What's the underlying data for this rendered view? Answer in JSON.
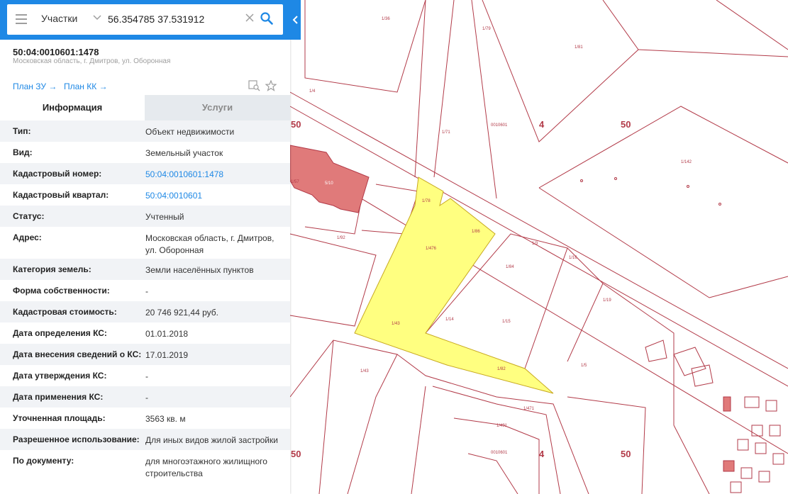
{
  "search": {
    "category": "Участки",
    "query": "56.354785 37.531912"
  },
  "object": {
    "cadastral_number": "50:04:0010601:1478",
    "address": "Московская область, г. Дмитров, ул. Оборонная"
  },
  "links": {
    "plan_zu": "План ЗУ →",
    "plan_kk": "План КК →"
  },
  "tabs": {
    "info": "Информация",
    "services": "Услуги"
  },
  "rows": [
    {
      "label": "Тип:",
      "value": "Объект недвижимости"
    },
    {
      "label": "Вид:",
      "value": "Земельный участок"
    },
    {
      "label": "Кадастровый номер:",
      "value": "50:04:0010601:1478"
    },
    {
      "label": "Кадастровый квартал:",
      "value": "50:04:0010601"
    },
    {
      "label": "Статус:",
      "value": "Учтенный"
    },
    {
      "label": "Адрес:",
      "value": "Московская область, г. Дмитров, ул. Оборонная"
    },
    {
      "label": "Категория земель:",
      "value": "Земли населённых пунктов"
    },
    {
      "label": "Форма собственности:",
      "value": "-"
    },
    {
      "label": "Кадастровая стоимость:",
      "value": "20 746 921,44 руб."
    },
    {
      "label": "Дата определения КС:",
      "value": "01.01.2018"
    },
    {
      "label": "Дата внесения сведений о КС:",
      "value": "17.01.2019"
    },
    {
      "label": "Дата утверждения КС:",
      "value": "-"
    },
    {
      "label": "Дата применения КС:",
      "value": "-"
    },
    {
      "label": "Уточненная площадь:",
      "value": "3563 кв. м"
    },
    {
      "label": "Разрешенное использование:",
      "value": "Для иных видов жилой застройки"
    },
    {
      "label": "По документу:",
      "value": "для многоэтажного жилищного строительства"
    }
  ],
  "map": {
    "zone_labels": [
      "50",
      "4",
      "50",
      "50",
      "4",
      "50"
    ],
    "quarter_labels": [
      "0010601",
      "0010601"
    ],
    "building_label": "5/10",
    "parcel_labels": [
      "1/36",
      "1/79",
      "1/81",
      "1/57",
      "1/78",
      "1/4",
      "1/476",
      "1/86",
      "1/84",
      "1/92",
      "1/142",
      "1/14",
      "1/15",
      "1/43",
      "1/82",
      "1/43",
      "1/5",
      "1/3",
      "1/16",
      "1/71",
      "1/471",
      "1/491",
      "1/19"
    ],
    "colors": {
      "boundary": "#b23a48",
      "selected_fill": "#ffff80",
      "selected_stroke": "#c7a820",
      "building": "#e07a7a",
      "accent": "#1e88e5"
    }
  }
}
